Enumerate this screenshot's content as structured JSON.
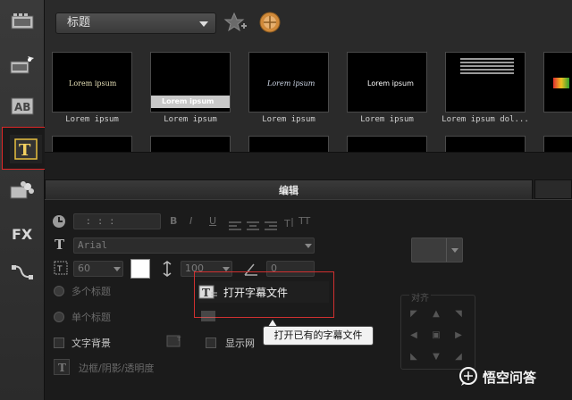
{
  "header": {
    "category": "标题"
  },
  "library": {
    "thumbnails": [
      {
        "overlay": "Lorem ipsum",
        "caption": "Lorem ipsum"
      },
      {
        "overlay": "Lorem ipsum",
        "caption": "Lorem ipsum"
      },
      {
        "overlay": "Lorem ipsum",
        "caption": "Lorem ipsum"
      },
      {
        "overlay": "Lorem ipsum",
        "caption": "Lorem ipsum"
      },
      {
        "overlay": "",
        "caption": "Lorem ipsum dol..."
      }
    ]
  },
  "panel": {
    "title": "编辑",
    "timecode": ":  :  :",
    "format": {
      "bold": "B",
      "italic": "I",
      "underline": "U",
      "tt": "TT"
    },
    "font": "Arial",
    "font_size": "60",
    "line_spacing": "100",
    "rotation": "0",
    "options": {
      "multi_title": "多个标题",
      "single_title": "单个标题",
      "text_background": "文字背景",
      "show_grid": "显示网",
      "border_shadow": "边框/阴影/透明度"
    },
    "align_label": "对齐"
  },
  "context_menu": {
    "open_subtitle": "打开字幕文件",
    "tooltip": "打开已有的字幕文件"
  },
  "watermark": {
    "text": "悟空问答"
  },
  "colors": {
    "highlight": "#d03030",
    "swatch": "#ffffff"
  }
}
